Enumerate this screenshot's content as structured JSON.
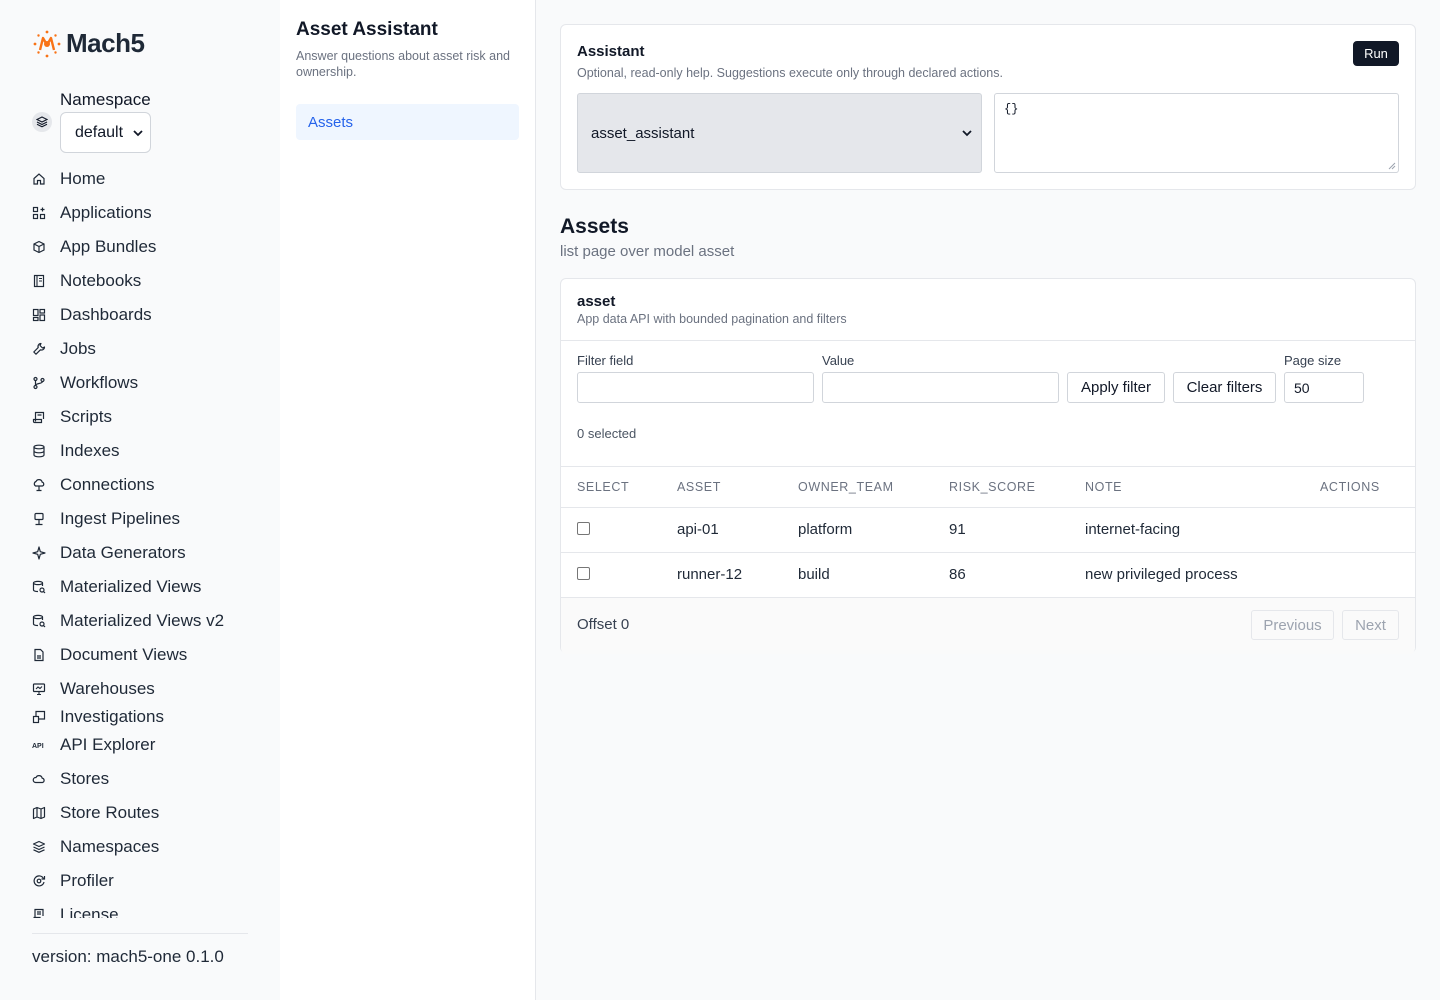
{
  "brand": {
    "name": "Mach5",
    "accent": "#f97316"
  },
  "namespace": {
    "label": "Namespace",
    "selected": "default"
  },
  "nav": {
    "items": [
      {
        "label": "Home",
        "icon": "home-icon"
      },
      {
        "label": "Applications",
        "icon": "applications-icon"
      },
      {
        "label": "App Bundles",
        "icon": "box-icon"
      },
      {
        "label": "Notebooks",
        "icon": "notebook-icon"
      },
      {
        "label": "Dashboards",
        "icon": "dashboard-icon"
      },
      {
        "label": "Jobs",
        "icon": "wrench-icon"
      },
      {
        "label": "Workflows",
        "icon": "git-branch-icon"
      },
      {
        "label": "Scripts",
        "icon": "script-icon"
      },
      {
        "label": "Indexes",
        "icon": "database-icon"
      },
      {
        "label": "Connections",
        "icon": "cloud-upload-icon"
      },
      {
        "label": "Ingest Pipelines",
        "icon": "pipeline-icon"
      },
      {
        "label": "Data Generators",
        "icon": "sparkle-icon"
      },
      {
        "label": "Materialized Views",
        "icon": "database-search-icon"
      },
      {
        "label": "Materialized Views v2",
        "icon": "database-search-icon"
      },
      {
        "label": "Document Views",
        "icon": "file-icon"
      },
      {
        "label": "Warehouses",
        "icon": "monitor-icon"
      },
      {
        "label": "Investigations",
        "icon": "investigation-icon"
      },
      {
        "label": "API Explorer",
        "icon": "api-icon"
      },
      {
        "label": "Stores",
        "icon": "cloud-icon"
      },
      {
        "label": "Store Routes",
        "icon": "map-icon"
      },
      {
        "label": "Namespaces",
        "icon": "layers-icon"
      },
      {
        "label": "Profiler",
        "icon": "profiler-icon"
      },
      {
        "label": "License",
        "icon": "license-icon"
      }
    ]
  },
  "version": "version: mach5-one 0.1.0",
  "app_panel": {
    "title": "Asset Assistant",
    "subtitle": "Answer questions about asset risk and ownership.",
    "items": [
      {
        "label": "Assets"
      }
    ]
  },
  "assistant": {
    "title": "Assistant",
    "subtitle": "Optional, read-only help. Suggestions execute only through declared actions.",
    "run_label": "Run",
    "selected": "asset_assistant",
    "input_value": "{}"
  },
  "assets_section": {
    "title": "Assets",
    "subtitle": "list page over model asset"
  },
  "table": {
    "name": "asset",
    "description": "App data API with bounded pagination and filters",
    "filter_field_label": "Filter field",
    "filter_field_value": "",
    "value_label": "Value",
    "value_value": "",
    "apply_label": "Apply filter",
    "clear_label": "Clear filters",
    "page_size_label": "Page size",
    "page_size_value": "50",
    "selected_text": "0 selected",
    "columns": [
      "SELECT",
      "ASSET",
      "OWNER_TEAM",
      "RISK_SCORE",
      "NOTE",
      "ACTIONS"
    ],
    "rows": [
      {
        "asset": "api-01",
        "owner_team": "platform",
        "risk_score": "91",
        "note": "internet-facing"
      },
      {
        "asset": "runner-12",
        "owner_team": "build",
        "risk_score": "86",
        "note": "new privileged process"
      }
    ],
    "offset_text": "Offset 0",
    "previous_label": "Previous",
    "next_label": "Next"
  }
}
